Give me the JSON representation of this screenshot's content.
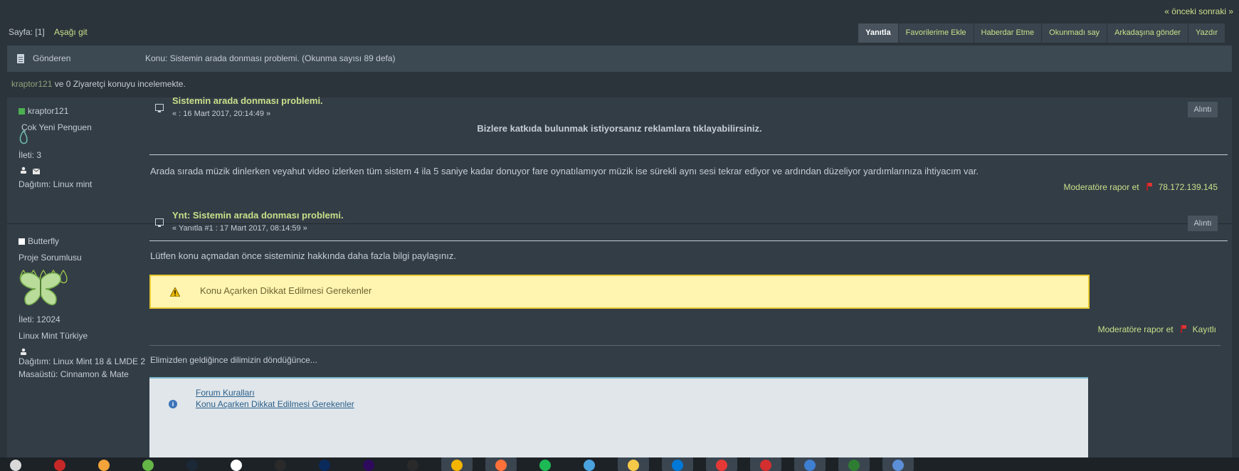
{
  "nav": {
    "prev_next": "« önceki sonraki »"
  },
  "page": {
    "label": "Sayfa: [1]",
    "goto_bottom": "Aşağı git"
  },
  "toolbar": {
    "buttons": [
      "Yanıtla",
      "Favorilerime Ekle",
      "Haberdar Etme",
      "Okunmadı say",
      "Arkadaşına gönder",
      "Yazdır"
    ]
  },
  "header": {
    "sender": "Gönderen",
    "subject": "Konu: Sistemin arada donması problemi.  (Okunma sayısı 89 defa)"
  },
  "viewers": {
    "user": "kraptor121",
    "text": " ve 0 Ziyaretçi konuyu incelemekte."
  },
  "posts": [
    {
      "author": "kraptor121",
      "rank": "Çok Yeni Penguen",
      "post_count": "İleti: 3",
      "distro": "Dağıtım: Linux mint",
      "title": "Sistemin arada donması problemi.",
      "date": "« : 16 Mart 2017, 20:14:49 »",
      "quote": "Alıntı",
      "ad_text": "Bizlere katkıda bulunmak istiyorsanız reklamlara tıklayabilirsiniz.",
      "body": "Arada sırada müzik dinlerken veyahut video izlerken tüm sistem 4 ila 5 saniye  kadar donuyor fare oynatılamıyor müzik ise sürekli aynı sesi tekrar ediyor ve ardından düzeliyor yardımlarınıza ihtiyacım var.",
      "report": "Moderatöre rapor et",
      "ip": "78.172.139.145"
    },
    {
      "author": "Butterfly",
      "rank": "Proje Sorumlusu",
      "post_count": "İleti: 12024",
      "team": "Linux Mint Türkiye",
      "distro": "Dağıtım: Linux Mint 18 & LMDE 2",
      "desktop": "Masaüstü: Cinnamon & Mate",
      "title": "Ynt: Sistemin arada donması problemi.",
      "date": "« Yanıtla #1 : 17 Mart 2017, 08:14:59 »",
      "quote": "Alıntı",
      "body": "Lütfen konu açmadan önce sisteminiz hakkında daha fazla bilgi paylaşınız.",
      "warning": "Konu Açarken Dikkat Edilmesi Gerekenler",
      "report": "Moderatöre rapor et",
      "ip": "Kayıtlı",
      "signature": "Elimizden geldiğince dilimizin döndüğünce...",
      "links": [
        "Forum Kuralları",
        "Konu Açarken Dikkat Edilmesi Gerekenler"
      ]
    }
  ],
  "taskbar": {
    "icons": [
      "os-icon",
      "app-icon",
      "media-icon",
      "torrent-icon",
      "steam-icon",
      "uplay-icon",
      "lightroom-icon",
      "photoshop-icon",
      "aftereffects-icon",
      "video-icon",
      "chrome-icon",
      "firefox-icon",
      "spotify-icon",
      "qbittorrent-icon",
      "explorer-icon",
      "store-icon",
      "game-icon",
      "opera-icon",
      "help-icon",
      "vpn-icon",
      "settings-icon"
    ],
    "colors": [
      "#d9d9d9",
      "#c62828",
      "#f2a33a",
      "#64b646",
      "#1b2838",
      "#ffffff",
      "#2a2a2a",
      "#0a2a5c",
      "#2d0a5c",
      "#2a2a2a",
      "#f4b400",
      "#ff7139",
      "#1db954",
      "#4aa3df",
      "#f7c948",
      "#0078d7",
      "#e53935",
      "#d32f2f",
      "#3f7fd1",
      "#2e7d32",
      "#5b8fd8"
    ]
  }
}
